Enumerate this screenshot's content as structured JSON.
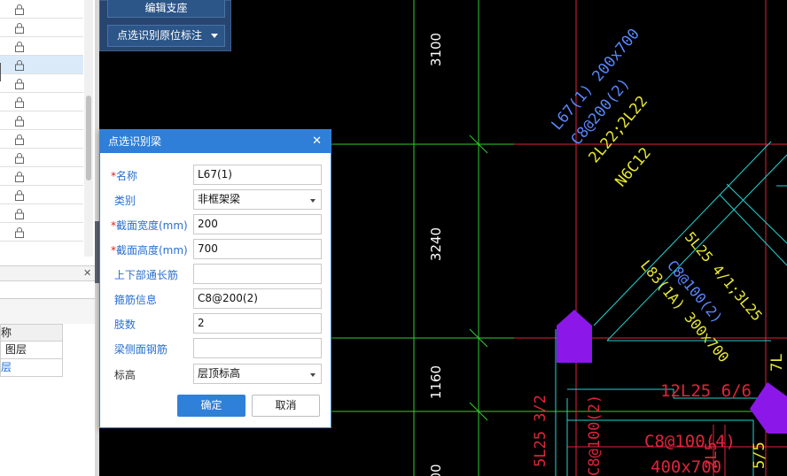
{
  "toolbar": {
    "edit_support_label": "编辑支座",
    "pick_identify_label": "点选识别原位标注"
  },
  "left_panel": {
    "table_header": "称",
    "table_row_1": "图层",
    "table_row_2": "层"
  },
  "dialog": {
    "title": "点选识别梁",
    "fields": [
      {
        "label": "名称",
        "required": true,
        "value": "L67(1)",
        "type": "text"
      },
      {
        "label": "类别",
        "required": false,
        "value": "非框架梁",
        "type": "select"
      },
      {
        "label": "截面宽度(mm)",
        "required": true,
        "value": "200",
        "type": "text"
      },
      {
        "label": "截面高度(mm)",
        "required": true,
        "value": "700",
        "type": "text"
      },
      {
        "label": "上下部通长筋",
        "required": false,
        "value": "",
        "type": "text"
      },
      {
        "label": "箍筋信息",
        "required": false,
        "value": "C8@200(2)",
        "type": "text"
      },
      {
        "label": "肢数",
        "required": false,
        "value": "2",
        "type": "text"
      },
      {
        "label": "梁侧面钢筋",
        "required": false,
        "value": "",
        "type": "text"
      },
      {
        "label": "标高",
        "required": false,
        "value": "层顶标高",
        "type": "select",
        "plain": true
      }
    ],
    "ok_label": "确定",
    "cancel_label": "取消"
  },
  "cad": {
    "dim_top": "3100",
    "dim_mid": "3240",
    "dim_bot": "1160",
    "dim_bottom_cut": "00",
    "blue_label_1": "L67(1) 200x700",
    "blue_label_2": "C8@200(2)",
    "yellow_label_1": "2L22;2L22",
    "yellow_label_2": "N6C12",
    "yellow_label_3": "5L25 4/1;3L25",
    "blue_label_3": "C8@100(2)",
    "blue_label_4": "L83(1A) 300x700",
    "red_label_1": "12L25 6/6",
    "red_label_2": "C8@100(4)",
    "red_label_3": "400x700",
    "red_label_4": "5L25 3/2",
    "red_label_5": "C8@100(2)",
    "red_label_6": "2L5",
    "yellow_label_4": "5/5",
    "yellow_label_5": "7L"
  },
  "colors": {
    "dialog_title_bg": "#2f7fd8",
    "toolbar_bg": "#27456e",
    "cad_bg": "#000000",
    "grid_green": "#2fd12f",
    "beam_cyan": "#22d3d3",
    "wall_red": "#e0243a",
    "col_purple": "#8b18e8"
  }
}
